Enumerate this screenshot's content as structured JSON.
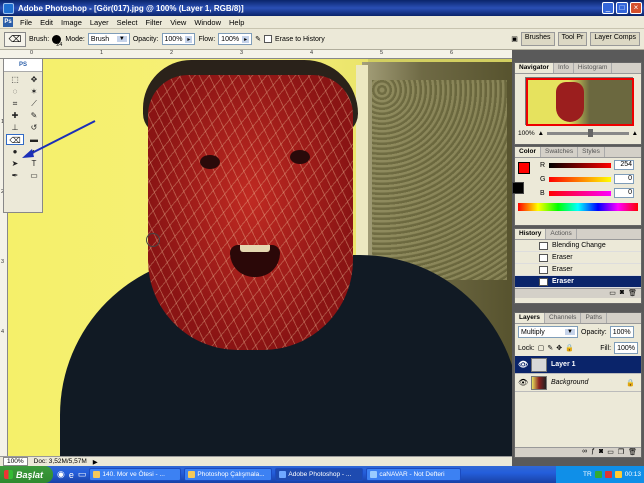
{
  "window": {
    "title": "Adobe Photoshop - [Gör(017).jpg @ 100% (Layer 1, RGB/8)]"
  },
  "menu": [
    "File",
    "Edit",
    "Image",
    "Layer",
    "Select",
    "Filter",
    "View",
    "Window",
    "Help"
  ],
  "options": {
    "brush_label": "Brush:",
    "brush_size": "24",
    "mode_label": "Mode:",
    "mode_value": "Brush",
    "opacity_label": "Opacity:",
    "opacity_value": "100%",
    "flow_label": "Flow:",
    "flow_value": "100%",
    "erase_history_label": "Erase to History",
    "well_tabs": [
      "Brushes",
      "Tool Pr",
      "Layer Comps"
    ]
  },
  "rulers": {
    "top": [
      "0",
      "1",
      "2",
      "3",
      "4",
      "5",
      "6"
    ],
    "left": [
      "1",
      "2",
      "3",
      "4"
    ]
  },
  "status": {
    "zoom": "100%",
    "doc": "Doc: 3,52M/5,57M"
  },
  "navigator": {
    "tabs": [
      "Navigator",
      "Info",
      "Histogram"
    ],
    "zoom": "100%"
  },
  "color": {
    "tabs": [
      "Color",
      "Swatches",
      "Styles"
    ],
    "channels": [
      {
        "name": "R",
        "value": "254",
        "color": "#fe0000"
      },
      {
        "name": "G",
        "value": "0",
        "color": "#00aa00"
      },
      {
        "name": "B",
        "value": "0",
        "color": "#0000ff"
      }
    ],
    "fg": "#fe0000",
    "bg": "#000000"
  },
  "history": {
    "tabs": [
      "History",
      "Actions"
    ],
    "items": [
      {
        "label": "Blending Change",
        "active": false
      },
      {
        "label": "Eraser",
        "active": false
      },
      {
        "label": "Eraser",
        "active": false
      },
      {
        "label": "Eraser",
        "active": true
      }
    ]
  },
  "layers": {
    "tabs": [
      "Layers",
      "Channels",
      "Paths"
    ],
    "blend_mode": "Multiply",
    "opacity_label": "Opacity:",
    "opacity_value": "100%",
    "lock_label": "Lock:",
    "fill_label": "Fill:",
    "fill_value": "100%",
    "items": [
      {
        "name": "Layer 1",
        "active": true
      },
      {
        "name": "Background",
        "active": false
      }
    ]
  },
  "taskbar": {
    "start_label": "Başlat",
    "tasks": [
      {
        "label": "140. Mor ve Ötesi - ...",
        "active": false
      },
      {
        "label": "Photoshop Çalışmala...",
        "active": false
      },
      {
        "label": "Adobe Photoshop - ...",
        "active": true
      },
      {
        "label": "caNAVAR - Not Defteri",
        "active": false
      }
    ],
    "lang": "TR",
    "clock": "00:13"
  }
}
